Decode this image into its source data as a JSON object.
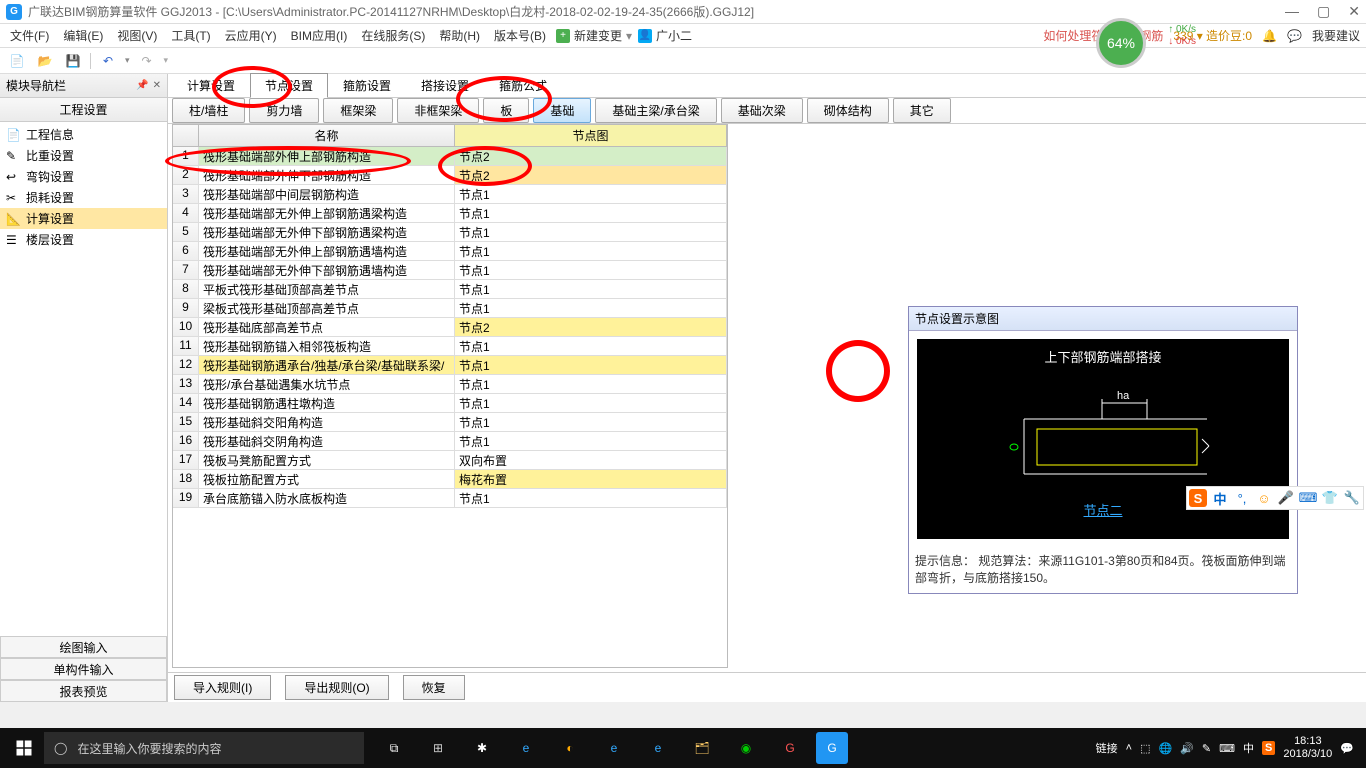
{
  "titlebar": {
    "app_icon_text": "G",
    "title": "广联达BIM钢筋算量软件 GGJ2013 - [C:\\Users\\Administrator.PC-20141127NRHM\\Desktop\\白龙村-2018-02-02-19-24-35(2666版).GGJ12]"
  },
  "menubar": {
    "items": [
      "文件(F)",
      "编辑(E)",
      "视图(V)",
      "工具(T)",
      "云应用(Y)",
      "BIM应用(I)",
      "在线服务(S)",
      "帮助(H)",
      "版本号(B)"
    ],
    "new_change": "新建变更",
    "user": "广小二",
    "right_link": "如何处理筏板附加钢筋",
    "price_label": "339 ▾  造价豆:0",
    "feedback": "我要建议",
    "net_pct": "64%",
    "net_up": "0K/s",
    "net_down": "0K/s"
  },
  "sidebar": {
    "header": "模块导航栏",
    "tabhead": "工程设置",
    "items": [
      {
        "label": "工程信息",
        "icon": "📄",
        "sel": false
      },
      {
        "label": "比重设置",
        "icon": "✎",
        "sel": false
      },
      {
        "label": "弯钩设置",
        "icon": "↩",
        "sel": false
      },
      {
        "label": "损耗设置",
        "icon": "✂",
        "sel": false
      },
      {
        "label": "计算设置",
        "icon": "📐",
        "sel": true
      },
      {
        "label": "楼层设置",
        "icon": "☰",
        "sel": false
      }
    ],
    "bottom": [
      "绘图输入",
      "单构件输入",
      "报表预览"
    ]
  },
  "tabs_top": [
    "计算设置",
    "节点设置",
    "箍筋设置",
    "搭接设置",
    "箍筋公式"
  ],
  "tabs_top_active": 1,
  "subtabs": [
    "柱/墙柱",
    "剪力墙",
    "框架梁",
    "非框架梁",
    "板",
    "基础",
    "基础主梁/承台梁",
    "基础次梁",
    "砌体结构",
    "其它"
  ],
  "subtabs_active": 5,
  "grid": {
    "head_name": "名称",
    "head_node": "节点图",
    "rows": [
      {
        "name": "筏形基础端部外伸上部钢筋构造",
        "node": "节点2",
        "cls": "hl-green"
      },
      {
        "name": "筏形基础端部外伸下部钢筋构造",
        "node": "节点2",
        "cls": "hl-yellow2"
      },
      {
        "name": "筏形基础端部中间层钢筋构造",
        "node": "节点1",
        "cls": ""
      },
      {
        "name": "筏形基础端部无外伸上部钢筋遇梁构造",
        "node": "节点1",
        "cls": ""
      },
      {
        "name": "筏形基础端部无外伸下部钢筋遇梁构造",
        "node": "节点1",
        "cls": ""
      },
      {
        "name": "筏形基础端部无外伸上部钢筋遇墙构造",
        "node": "节点1",
        "cls": ""
      },
      {
        "name": "筏形基础端部无外伸下部钢筋遇墙构造",
        "node": "节点1",
        "cls": ""
      },
      {
        "name": "平板式筏形基础顶部高差节点",
        "node": "节点1",
        "cls": ""
      },
      {
        "name": "梁板式筏形基础顶部高差节点",
        "node": "节点1",
        "cls": ""
      },
      {
        "name": "筏形基础底部高差节点",
        "node": "节点2",
        "cls": "hl-yellow"
      },
      {
        "name": "筏形基础钢筋锚入相邻筏板构造",
        "node": "节点1",
        "cls": ""
      },
      {
        "name": "筏形基础钢筋遇承台/独基/承台梁/基础联系梁/",
        "node": "节点1",
        "cls": "hl-row-yellow"
      },
      {
        "name": "筏形/承台基础遇集水坑节点",
        "node": "节点1",
        "cls": ""
      },
      {
        "name": "筏形基础钢筋遇柱墩构造",
        "node": "节点1",
        "cls": ""
      },
      {
        "name": "筏形基础斜交阳角构造",
        "node": "节点1",
        "cls": ""
      },
      {
        "name": "筏形基础斜交阴角构造",
        "node": "节点1",
        "cls": ""
      },
      {
        "name": "筏板马凳筋配置方式",
        "node": "双向布置",
        "cls": ""
      },
      {
        "name": "筏板拉筋配置方式",
        "node": "梅花布置",
        "cls": "hl-yellow"
      },
      {
        "name": "承台底筋锚入防水底板构造",
        "node": "节点1",
        "cls": ""
      }
    ]
  },
  "actions": {
    "import": "导入规则(I)",
    "export": "导出规则(O)",
    "restore": "恢复"
  },
  "preview": {
    "head": "节点设置示意图",
    "diagram_title": "上下部钢筋端部搭接",
    "ha_label": "ha",
    "link": "节点二",
    "tip_label": "提示信息：",
    "tip_text": "规范算法：来源11G101-3第80页和84页。筏板面筋伸到端部弯折，与底筋搭接150。"
  },
  "side_toolbar": {
    "zhong": "中"
  },
  "taskbar": {
    "search_placeholder": "在这里输入你要搜索的内容",
    "tray_link": "链接",
    "tray_zhong": "中",
    "time": "18:13",
    "date": "2018/3/10"
  }
}
